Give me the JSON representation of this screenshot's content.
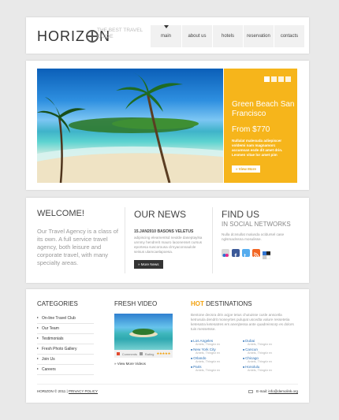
{
  "header": {
    "logo": "HORIZ",
    "logo_end": "N",
    "tagline": "THE BEST TRAVEL GUIDE",
    "nav": [
      "main",
      "about us",
      "hotels",
      "reservation",
      "contacts"
    ]
  },
  "hero": {
    "title": "Green Beach San Francisco",
    "price": "From $770",
    "description": "Nullalat malesuda adiepiscer voldemi nam magnamorc accumsan esde dit amet drin. Lesmen vitae lor amet pim",
    "button": "» View More",
    "slides": 4,
    "colors": {
      "accent": "#f6b51b"
    }
  },
  "welcome": {
    "title": "WELCOME!",
    "text": "Our Travel Agency is a class of its own. A full service travel agency, both leisure and corporate travel, with many specialty areas."
  },
  "news": {
    "title": "OUR NEWS",
    "date_line": "15.JAN2010 BASONS VELETUS",
    "text": "adipiscing eleamentsd neulde daseptaylsa unnmy hendrerit mauro laoonenset cursus eportesa suscorousa clrnyaconnaulole seisus ulamcaelapoesa.",
    "button": "» More News"
  },
  "social": {
    "title": "FIND US",
    "subtitle": "IN SOCIAL NETWORKS",
    "text": "Nulla dcnsullat malusda ocldursel case nglsmaclssna mosulisse."
  },
  "categories": {
    "title": "CATEGORIES",
    "items": [
      "On-line Travel Club",
      "Our Team",
      "Testimonials",
      "Fresh Photo Gallery",
      "Join Us",
      "Careers"
    ]
  },
  "video": {
    "title": "FRESH VIDEO",
    "comments_label": "Comments",
    "rating_label": "Rating",
    "stars": "★★★★★",
    "link": "» View More Videos"
  },
  "destinations": {
    "title_hot": "HOT",
    "title_rest": " DESTINATIONS",
    "text": "Bentone decsra drin acjpe tetus chutuisse cusle anscetla ketrusula dendrit moneyrtes pulupat uscedta valure ressetetia ketesatra ketesatres ers anenjtessa ante quadreinsorp es dolors tuis messetsse.",
    "items": [
      {
        "name": "Los Angeles",
        "note": "Antels, Thingrlz ex"
      },
      {
        "name": "Dubai",
        "note": "Antels, Thingrlz ex"
      },
      {
        "name": "New York City",
        "note": "Antels, Thingrlz ex"
      },
      {
        "name": "Cancun",
        "note": "Antels, Thingrlz ex"
      },
      {
        "name": "Orlando",
        "note": "Antels, Thingrlz ex"
      },
      {
        "name": "Chicago",
        "note": "Antels, Thingrlz ex"
      },
      {
        "name": "Paris",
        "note": "Antels, Thingrlz ex"
      },
      {
        "name": "Honolulu",
        "note": "Antels, Thingrlz ex"
      }
    ]
  },
  "footer": {
    "copyright": "HORIZON © 2011 |",
    "privacy": "PRIVACY POLICY",
    "email_label": "E-mail:",
    "email": "info@demolink.org"
  }
}
